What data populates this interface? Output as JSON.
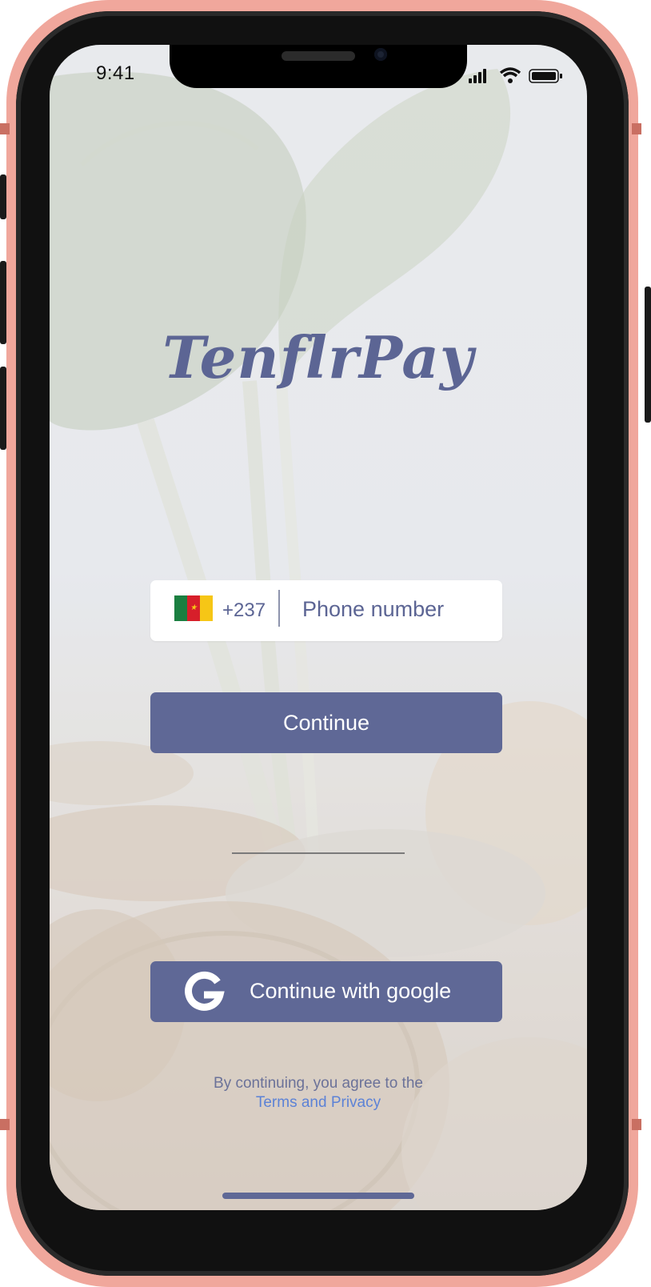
{
  "status_bar": {
    "time": "9:41",
    "icons": [
      "cellular-signal-icon",
      "wifi-icon",
      "battery-icon"
    ]
  },
  "brand": {
    "logo_text": "TenflrPay",
    "color": "#5c6594"
  },
  "phone_field": {
    "country_flag": "cameroon-flag-icon",
    "dial_code": "+237",
    "placeholder": "Phone number",
    "value": ""
  },
  "continue_button": {
    "label": "Continue",
    "color": "#5f6896"
  },
  "google_button": {
    "label": "Continue with google",
    "icon": "google-icon"
  },
  "legal": {
    "text": "By continuing, you agree to the",
    "link": "Terms and Privacy",
    "link_color": "#5c82d6"
  },
  "device": {
    "frame_color": "#f0a79c"
  }
}
